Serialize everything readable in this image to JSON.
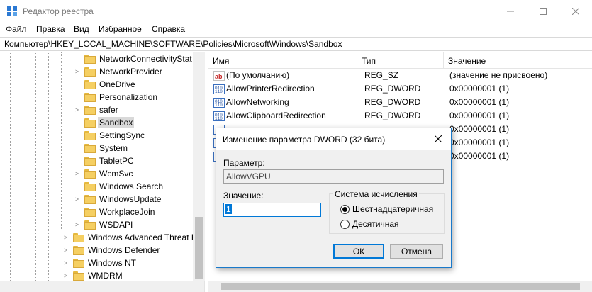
{
  "window": {
    "title": "Редактор реестра",
    "min_icon": "minimize-icon",
    "max_icon": "maximize-icon",
    "close_icon": "close-icon"
  },
  "menu": [
    "Файл",
    "Правка",
    "Вид",
    "Избранное",
    "Справка"
  ],
  "address": "Компьютер\\HKEY_LOCAL_MACHINE\\SOFTWARE\\Policies\\Microsoft\\Windows\\Sandbox",
  "tree": {
    "items": [
      {
        "label": "NetworkConnectivityStat",
        "expander": ""
      },
      {
        "label": "NetworkProvider",
        "expander": ">"
      },
      {
        "label": "OneDrive",
        "expander": ""
      },
      {
        "label": "Personalization",
        "expander": ""
      },
      {
        "label": "safer",
        "expander": ">"
      },
      {
        "label": "Sandbox",
        "expander": "",
        "selected": true
      },
      {
        "label": "SettingSync",
        "expander": ""
      },
      {
        "label": "System",
        "expander": ""
      },
      {
        "label": "TabletPC",
        "expander": ""
      },
      {
        "label": "WcmSvc",
        "expander": ">"
      },
      {
        "label": "Windows Search",
        "expander": ""
      },
      {
        "label": "WindowsUpdate",
        "expander": ">"
      },
      {
        "label": "WorkplaceJoin",
        "expander": ""
      },
      {
        "label": "WSDAPI",
        "expander": ">"
      },
      {
        "label": "Windows Advanced Threat P",
        "expander": ">"
      },
      {
        "label": "Windows Defender",
        "expander": ">"
      },
      {
        "label": "Windows NT",
        "expander": ">"
      },
      {
        "label": "WMDRM",
        "expander": ">"
      }
    ]
  },
  "list": {
    "columns": [
      "Имя",
      "Тип",
      "Значение"
    ],
    "rows": [
      {
        "icon": "string-value-icon",
        "name": "(По умолчанию)",
        "type": "REG_SZ",
        "value": "(значение не присвоено)"
      },
      {
        "icon": "binary-value-icon",
        "name": "AllowPrinterRedirection",
        "type": "REG_DWORD",
        "value": "0x00000001 (1)"
      },
      {
        "icon": "binary-value-icon",
        "name": "AllowNetworking",
        "type": "REG_DWORD",
        "value": "0x00000001 (1)"
      },
      {
        "icon": "binary-value-icon",
        "name": "AllowClipboardRedirection",
        "type": "REG_DWORD",
        "value": "0x00000001 (1)"
      },
      {
        "icon": "binary-value-icon",
        "name": "",
        "type": "",
        "value": "0x00000001 (1)"
      },
      {
        "icon": "binary-value-icon",
        "name": "",
        "type": "",
        "value": "0x00000001 (1)"
      },
      {
        "icon": "binary-value-icon",
        "name": "",
        "type": "",
        "value": "0x00000001 (1)"
      }
    ]
  },
  "dialog": {
    "title": "Изменение параметра DWORD (32 бита)",
    "param_label": "Параметр:",
    "param_value": "AllowVGPU",
    "value_label": "Значение:",
    "value_data": "1",
    "base_label": "Система исчисления",
    "radio_hex": "Шестнадцатеричная",
    "radio_dec": "Десятичная",
    "selected_base": "hex",
    "ok": "ОК",
    "cancel": "Отмена"
  }
}
